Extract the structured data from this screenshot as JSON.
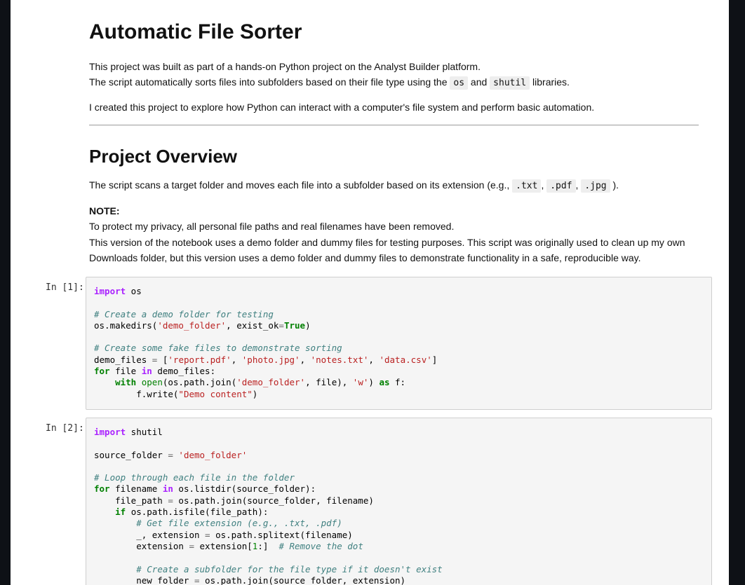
{
  "title": "Automatic File Sorter",
  "intro": {
    "line1": "This project was built as part of a hands-on Python project on the Analyst Builder platform.",
    "line2_pre": "The script automatically sorts files into subfolders based on their file type using the",
    "code_os": "os",
    "and": "and",
    "code_shutil": "shutil",
    "line2_post": "libraries.",
    "line3": "I created this project to explore how Python can interact with a computer's file system and perform basic automation."
  },
  "overview": {
    "heading": "Project Overview",
    "line_pre": "The script scans a target folder and moves each file into a subfolder based on its extension (e.g.,",
    "ext1": ".txt",
    "ext2": ".pdf",
    "ext3": ".jpg",
    "comma": ",",
    "line_post": ").",
    "note_label": "NOTE:",
    "note1": "To protect my privacy, all personal file paths and real filenames have been removed.",
    "note2": "This version of the notebook uses a demo folder and dummy files for testing purposes. This script was originally used to clean up my own",
    "note3": "Downloads folder, but this version uses a demo folder and dummy files to demonstrate functionality in a safe, reproducible way."
  },
  "cells": [
    {
      "prompt": "In [1]:"
    },
    {
      "prompt": "In [2]:"
    }
  ]
}
